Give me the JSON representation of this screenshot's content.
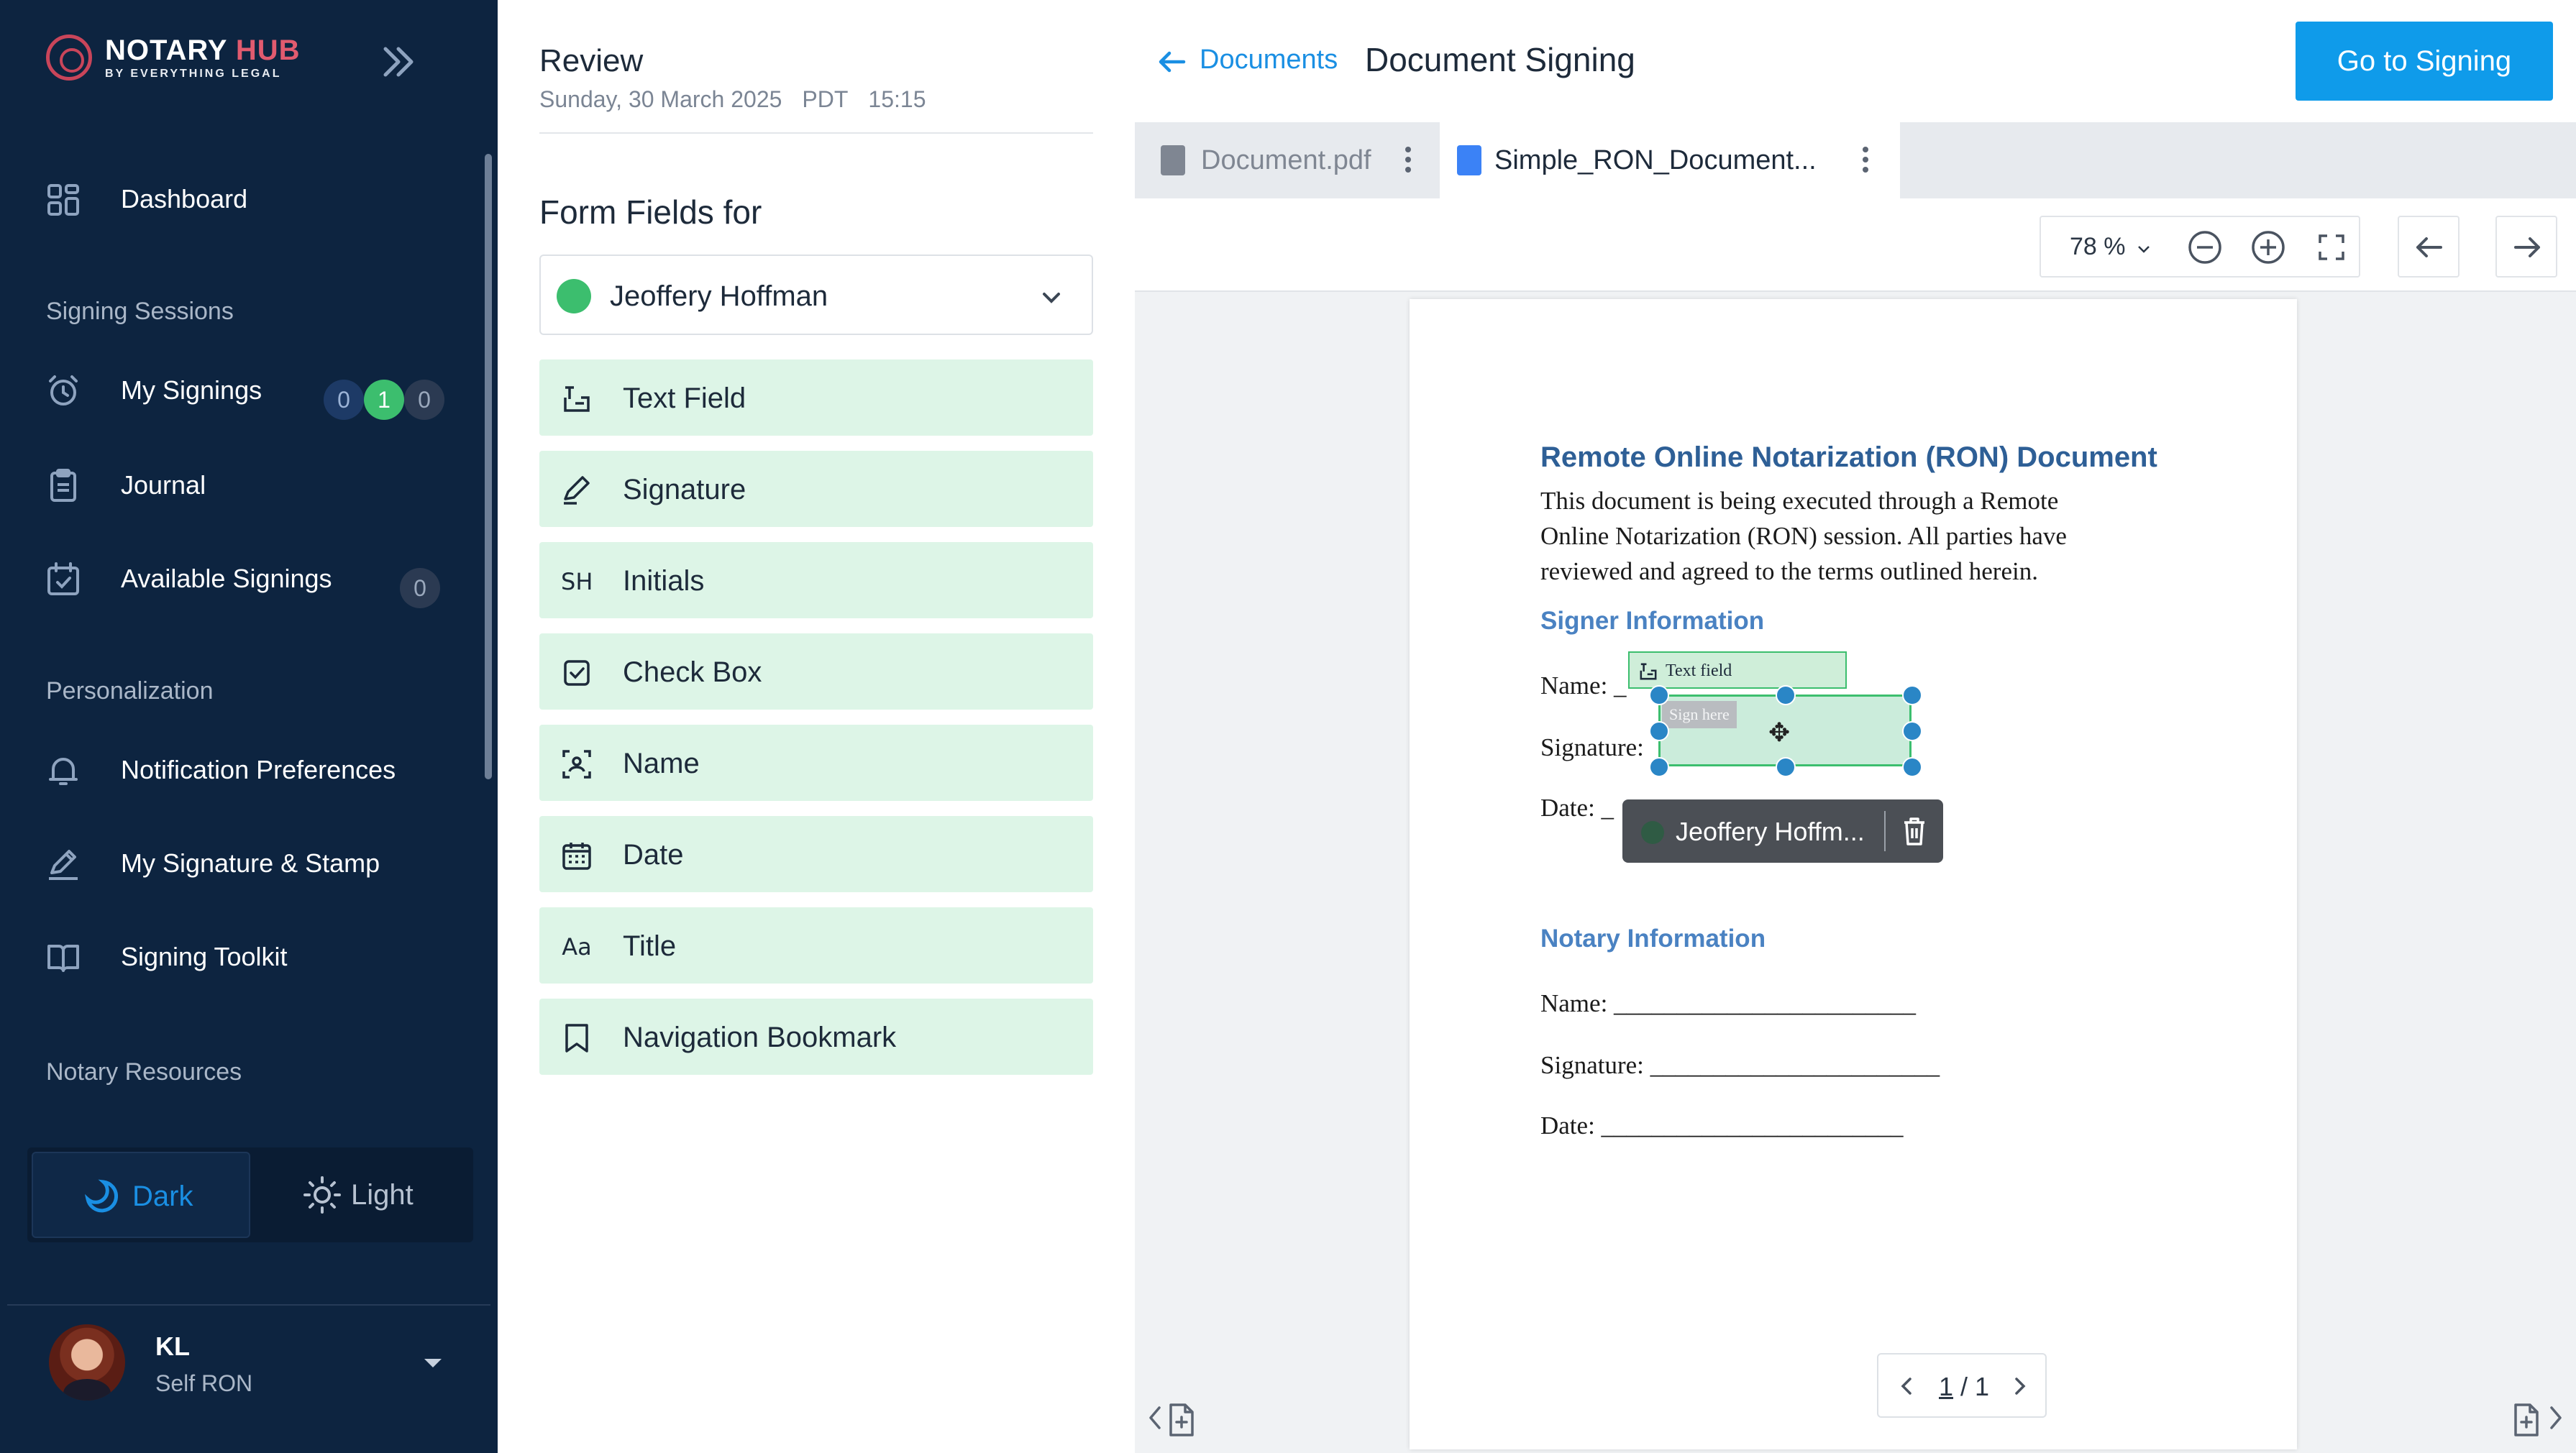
{
  "sidebar": {
    "logo": {
      "name_part1": "NOTARY",
      "name_part2": "HUB",
      "tagline": "BY EVERYTHING LEGAL"
    },
    "nav": {
      "dashboard": "Dashboard",
      "signing_sessions_heading": "Signing Sessions",
      "my_signings": "My Signings",
      "my_signings_badges": [
        "0",
        "1",
        "0"
      ],
      "journal": "Journal",
      "available_signings": "Available Signings",
      "available_signings_badge": "0",
      "personalization_heading": "Personalization",
      "notification_preferences": "Notification Preferences",
      "signature_stamp": "My Signature & Stamp",
      "signing_toolkit": "Signing Toolkit",
      "notary_resources_heading": "Notary Resources"
    },
    "theme": {
      "dark": "Dark",
      "light": "Light",
      "selected": "Dark"
    },
    "user": {
      "initials": "KL",
      "role": "Self RON"
    }
  },
  "fields_panel": {
    "review_title": "Review",
    "date": "Sunday, 30 March 2025",
    "tz": "PDT",
    "time": "15:15",
    "form_fields_title": "Form Fields for",
    "signer": {
      "name": "Jeoffery Hoffman",
      "color": "#3cbe6e"
    },
    "fields": [
      {
        "icon": "text-field-icon",
        "label": "Text Field"
      },
      {
        "icon": "signature-icon",
        "label": "Signature"
      },
      {
        "icon": "initials-icon",
        "label": "Initials",
        "glyph": "SH"
      },
      {
        "icon": "checkbox-icon",
        "label": "Check Box"
      },
      {
        "icon": "name-icon",
        "label": "Name"
      },
      {
        "icon": "calendar-icon",
        "label": "Date"
      },
      {
        "icon": "title-icon",
        "label": "Title",
        "glyph": "Aa"
      },
      {
        "icon": "bookmark-icon",
        "label": "Navigation Bookmark"
      }
    ]
  },
  "doc_area": {
    "back_label": "Documents",
    "title": "Document Signing",
    "go_button": "Go to Signing",
    "tabs": [
      {
        "label": "Document.pdf",
        "active": false
      },
      {
        "label": "Simple_RON_Document...",
        "active": true
      }
    ],
    "zoom": "78 %",
    "page_indicator": {
      "current": "1",
      "total": "1"
    },
    "accent": "#0f9bea"
  },
  "document": {
    "heading": "Remote Online Notarization (RON) Document",
    "paragraph_lines": [
      "This document is being executed through a Remote",
      "Online Notarization (RON) session. All parties have",
      "reviewed and agreed to the terms outlined herein."
    ],
    "signer_info_heading": "Signer Information",
    "signer_lines": {
      "name": "Name: _",
      "signature": "Signature:",
      "date": "Date: _"
    },
    "notary_info_heading": "Notary Information",
    "notary_lines": {
      "name": "Name: ________________________",
      "signature": "Signature: _______________________",
      "date": "Date: ________________________"
    },
    "text_field_tag": "Text field",
    "sign_placeholder": "Sign here",
    "assigned_signer": "Jeoffery Hoffm..."
  }
}
